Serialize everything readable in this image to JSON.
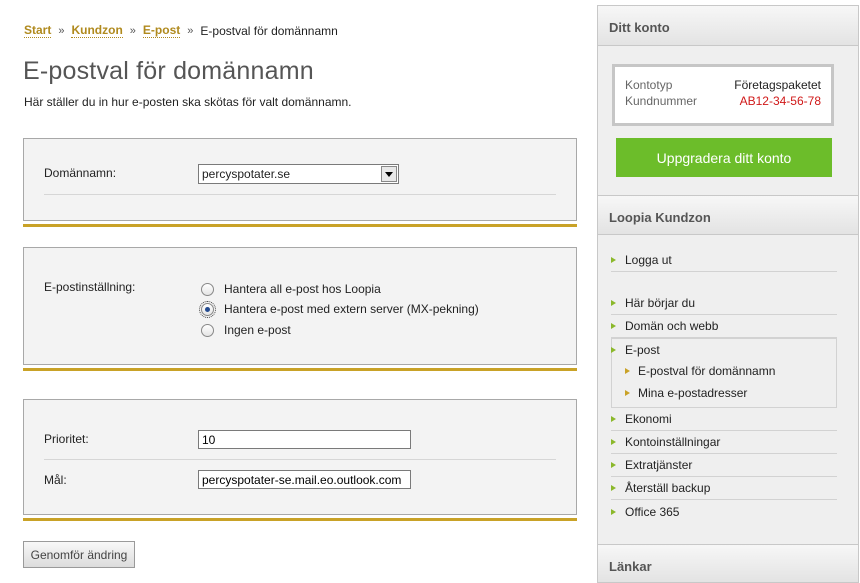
{
  "breadcrumb": {
    "items": [
      "Start",
      "Kundzon",
      "E-post"
    ],
    "current": "E-postval för domännamn",
    "separator": "»"
  },
  "page": {
    "title": "E-postval för domännamn",
    "intro": "Här ställer du in hur e-posten ska skötas för valt domännamn."
  },
  "domain_panel": {
    "label": "Domännamn:",
    "selected": "percyspotater.se"
  },
  "email_panel": {
    "label": "E-postinställning:",
    "options": [
      {
        "label": "Hantera all e-post hos Loopia",
        "checked": false
      },
      {
        "label": "Hantera e-post med extern server (MX-pekning)",
        "checked": true
      },
      {
        "label": "Ingen e-post",
        "checked": false
      }
    ]
  },
  "mx_panel": {
    "priority_label": "Prioritet:",
    "priority_value": "10",
    "target_label": "Mål:",
    "target_value": "percyspotater-se.mail.eo.outlook.com"
  },
  "submit_label": "Genomför ändring",
  "sidebar": {
    "account": {
      "heading": "Ditt konto",
      "type_label": "Kontotyp",
      "type_value": "Företagspaketet",
      "customer_label": "Kundnummer",
      "customer_value": "AB12-34-56-78",
      "upgrade_label": "Uppgradera ditt konto"
    },
    "zone": {
      "heading": "Loopia Kundzon",
      "logout": "Logga ut",
      "items": [
        "Här börjar du",
        "Domän och webb",
        "E-post"
      ],
      "email_subitems": [
        "E-postval för domännamn",
        "Mina e-postadresser"
      ],
      "items_after": [
        "Ekonomi",
        "Kontoinställningar",
        "Extratjänster",
        "Återställ backup",
        "Office 365"
      ]
    },
    "links_heading": "Länkar"
  },
  "colors": {
    "accent_gold": "#c9a227",
    "upgrade_green": "#6cbd2a",
    "customer_red": "#d01818"
  }
}
